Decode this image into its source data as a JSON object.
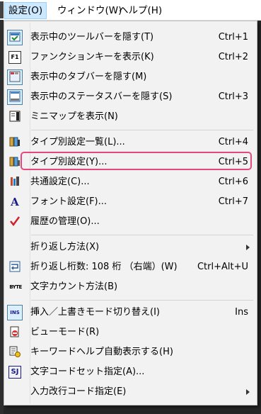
{
  "menubar": {
    "items": [
      {
        "label": "設定(O)",
        "active": true
      },
      {
        "label": "ウィンドウ(W)",
        "active": false
      },
      {
        "label": "ヘルプ(H)",
        "active": false
      }
    ]
  },
  "menu": {
    "items": [
      {
        "label": "表示中のツールバーを隠す(T)",
        "shortcut": "Ctrl+1",
        "icon": "toolbar-icon",
        "checked": true
      },
      {
        "label": "ファンクションキーを表示(K)",
        "shortcut": "Ctrl+2",
        "icon": "function-key-icon",
        "checked": false
      },
      {
        "label": "表示中のタブバーを隠す(M)",
        "shortcut": "",
        "icon": "tabbar-icon",
        "checked": true
      },
      {
        "label": "表示中のステータスバーを隠す(S)",
        "shortcut": "Ctrl+3",
        "icon": "statusbar-icon",
        "checked": true
      },
      {
        "label": "ミニマップを表示(N)",
        "shortcut": "",
        "icon": "minimap-icon",
        "checked": false
      },
      {
        "label": "タイプ別設定一覧(L)...",
        "shortcut": "Ctrl+4",
        "icon": "type-settings-list-icon",
        "checked": false
      },
      {
        "label": "タイプ別設定(Y)...",
        "shortcut": "Ctrl+5",
        "icon": "type-settings-icon",
        "checked": false,
        "highlighted": true
      },
      {
        "label": "共通設定(C)...",
        "shortcut": "Ctrl+6",
        "icon": "common-settings-icon",
        "checked": false
      },
      {
        "label": "フォント設定(F)...",
        "shortcut": "Ctrl+7",
        "icon": "font-icon",
        "checked": false
      },
      {
        "label": "履歴の管理(O)...",
        "shortcut": "",
        "icon": "checkmark-icon",
        "checked": false
      },
      {
        "label": "折り返し方法(X)",
        "shortcut": "",
        "icon": "",
        "submenu": true
      },
      {
        "label": "折り返し桁数: 108 桁 （右端）(W)",
        "shortcut": "Ctrl+Alt+U",
        "icon": "wrap-icon",
        "checked": false
      },
      {
        "label": "文字カウント方法(B)",
        "shortcut": "",
        "icon": "byte-icon",
        "checked": false
      },
      {
        "label": "挿入／上書きモード切り替え(I)",
        "shortcut": "Ins",
        "icon": "insert-mode-icon",
        "checked": true
      },
      {
        "label": "ビューモード(R)",
        "shortcut": "",
        "icon": "view-mode-icon",
        "checked": false
      },
      {
        "label": "キーワードヘルプ自動表示する(H)",
        "shortcut": "",
        "icon": "keyword-help-icon",
        "checked": false
      },
      {
        "label": "文字コードセット指定(A)...",
        "shortcut": "",
        "icon": "charset-icon",
        "checked": false
      },
      {
        "label": "入力改行コード指定(E)",
        "shortcut": "",
        "icon": "",
        "submenu": true
      }
    ]
  },
  "icon_text": {
    "function_key": "F1",
    "font": "A",
    "byte": "BYTE",
    "insert": "INS",
    "charset": "SJ"
  },
  "colors": {
    "highlight_border": "#e8477c",
    "menu_bg": "#f2f2f2",
    "active_menubar_bg": "#cce8ff"
  }
}
